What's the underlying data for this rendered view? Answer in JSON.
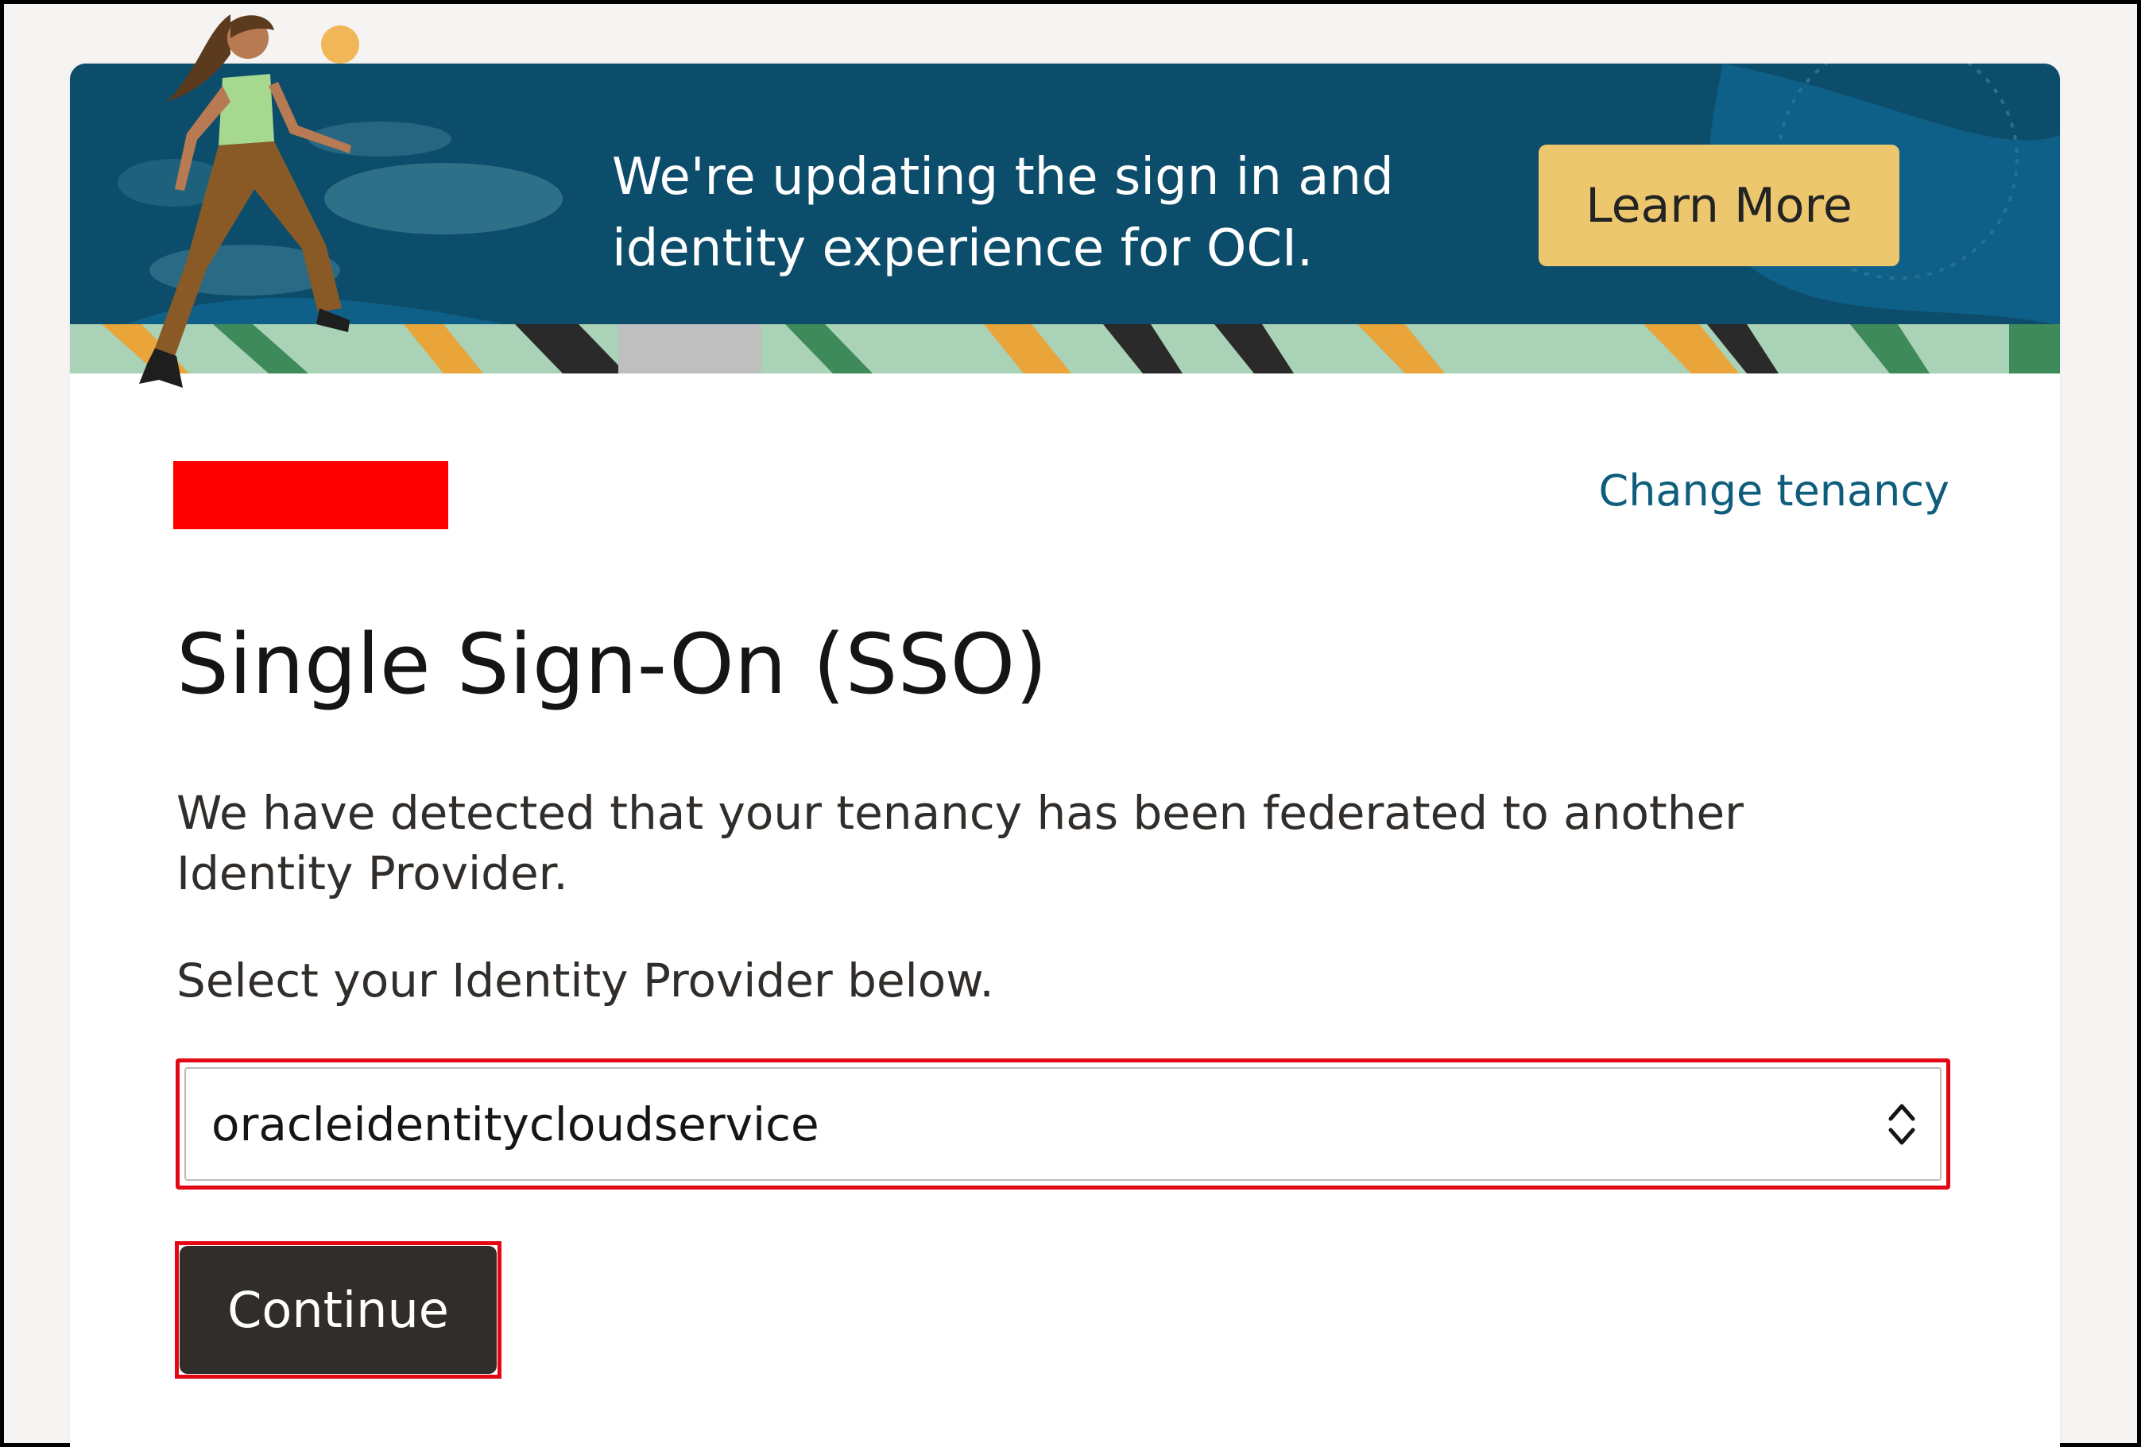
{
  "banner": {
    "line1": "We're updating the sign in and",
    "line2": "identity experience for OCI.",
    "learn_more_label": "Learn More",
    "background_color": "#0c4d6b",
    "button_color": "#ecc76e"
  },
  "header": {
    "change_tenancy_label": "Change tenancy"
  },
  "main": {
    "title": "Single Sign-On (SSO)",
    "description": "We have detected that your tenancy has been federated to another Identity Provider.",
    "select_prompt": "Select your Identity Provider below.",
    "identity_provider_value": "oracleidentitycloudservice",
    "continue_label": "Continue"
  },
  "colors": {
    "highlight": "#e30613",
    "link": "#0f5d7d",
    "primary_button": "#312d2a"
  }
}
